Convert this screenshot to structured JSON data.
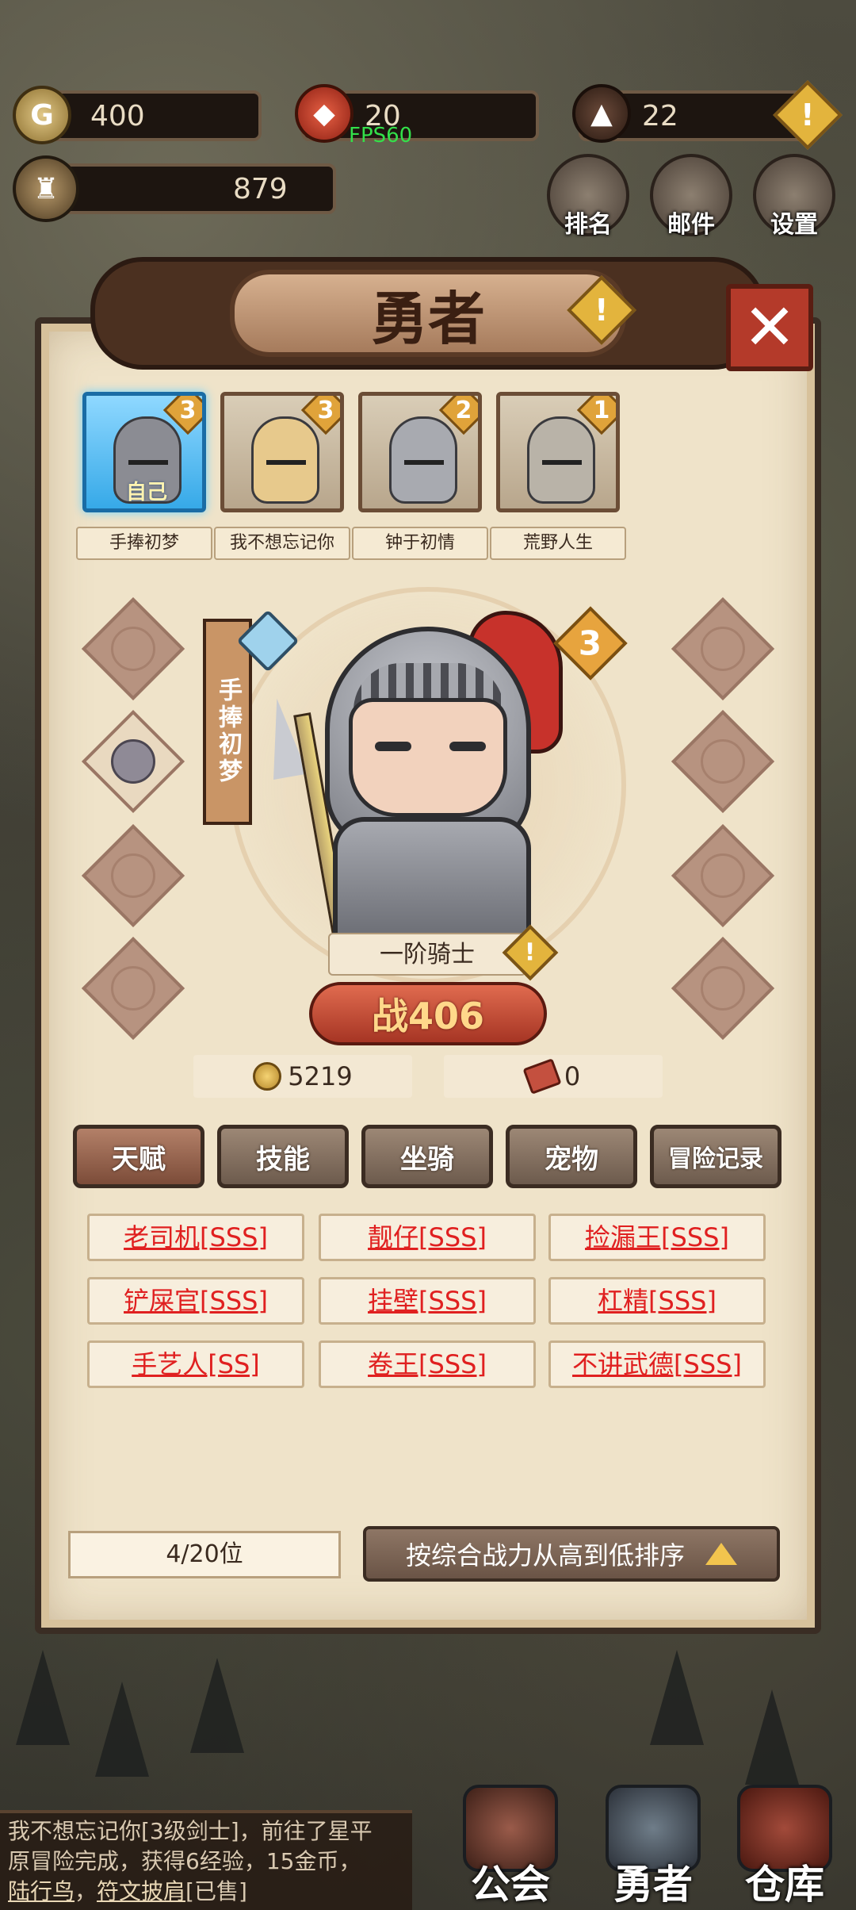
{
  "hud": {
    "coins": "400",
    "tokens": "20",
    "fps": "FPS60",
    "gems": "22",
    "power_total": "879",
    "buttons": {
      "rank": "排名",
      "mail": "邮件",
      "settings": "设置"
    }
  },
  "panel": {
    "title": "勇者",
    "heroes": [
      {
        "name": "手捧初梦",
        "level": "3",
        "self_tag": "自己"
      },
      {
        "name": "我不想忘记你",
        "level": "3"
      },
      {
        "name": "钟于初情",
        "level": "2"
      },
      {
        "name": "荒野人生",
        "level": "1"
      }
    ],
    "selected": {
      "banner_name": "手捧初梦",
      "rank": "3",
      "class": "一阶骑士",
      "power": "战406",
      "gold": "5219",
      "tickets": "0"
    },
    "tabs": [
      "天赋",
      "技能",
      "坐骑",
      "宠物",
      "冒险记录"
    ],
    "talents": [
      "老司机[SSS]",
      "靓仔[SSS]",
      "捡漏王[SSS]",
      "铲屎官[SSS]",
      "挂壁[SSS]",
      "杠精[SSS]",
      "手艺人[SS]",
      "卷王[SSS]",
      "不讲武德[SSS]"
    ],
    "count": "4/20位",
    "sort_label": "按综合战力从高到低排序"
  },
  "chat": {
    "line1": "我不想忘记你[3级剑士]，前往了星平",
    "line2": "原冒险完成，获得6经验，15金币，",
    "link1": "陆行鸟",
    "sep": "，",
    "link2": "符文披肩",
    "tail": "[已售]"
  },
  "bottom_nav": [
    "公会",
    "勇者",
    "仓库"
  ],
  "colors": {
    "panel_bg": "#efe3c9",
    "talent_text": "#e02020",
    "selected_card": "#36a9e8",
    "fps_text": "#33e04a"
  }
}
